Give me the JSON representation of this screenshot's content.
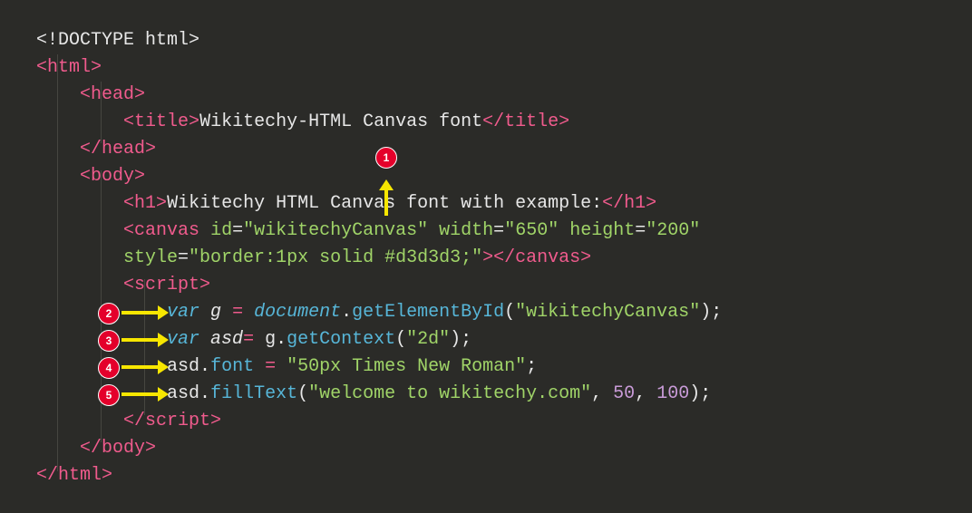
{
  "lines": {
    "l1": "<!DOCTYPE html>",
    "l2_open": "<",
    "l2_tag": "html",
    "l2_close": ">",
    "l3_open": "<",
    "l3_tag": "head",
    "l3_close": ">",
    "l4_open": "<",
    "l4_tag": "title",
    "l4_mid": ">",
    "l4_text": "Wikitechy-HTML Canvas font",
    "l4_copen": "</",
    "l4_cclose": ">",
    "l5_open": "</",
    "l5_tag": "head",
    "l5_close": ">",
    "l6_open": "<",
    "l6_tag": "body",
    "l6_close": ">",
    "l7_open": "<",
    "l7_tag": "h1",
    "l7_mid": ">",
    "l7_text": "Wikitechy HTML Canvas font with example:",
    "l7_copen": "</",
    "l7_cclose": ">",
    "l8_open": "<",
    "l8_tag": "canvas",
    "l8_sp": " ",
    "l8_a1": "id",
    "l8_eq": "=",
    "l8_v1": "\"wikitechyCanvas\"",
    "l8_a2": "width",
    "l8_v2": "\"650\"",
    "l8_a3": "height",
    "l8_v3": "\"200\"",
    "l9_a4": "style",
    "l9_v4": "\"border:1px solid #d3d3d3;\"",
    "l9_mid": ">",
    "l9_copen": "</",
    "l9_ctag": "canvas",
    "l9_cclose": ">",
    "l10_open": "<",
    "l10_tag": "script",
    "l10_close": ">",
    "l11_var": "var",
    "l11_g": " g ",
    "l11_eq": "= ",
    "l11_doc": "document",
    "l11_dot": ".",
    "l11_fn": "getElementById",
    "l11_p1": "(",
    "l11_str": "\"wikitechyCanvas\"",
    "l11_p2": ");",
    "l12_var": "var",
    "l12_asd": " asd",
    "l12_eq": "= ",
    "l12_g": "g",
    "l12_dot": ".",
    "l12_fn": "getContext",
    "l12_p1": "(",
    "l12_str": "\"2d\"",
    "l12_p2": ");",
    "l13_obj": "asd",
    "l13_dot": ".",
    "l13_prop": "font",
    "l13_sp": " ",
    "l13_eq": "= ",
    "l13_str": "\"50px Times New Roman\"",
    "l13_end": ";",
    "l14_obj": "asd",
    "l14_dot": ".",
    "l14_fn": "fillText",
    "l14_p1": "(",
    "l14_str": "\"welcome to wikitechy.com\"",
    "l14_c1": ", ",
    "l14_n1": "50",
    "l14_c2": ", ",
    "l14_n2": "100",
    "l14_p2": ");",
    "l15_open": "</",
    "l15_tag": "script",
    "l15_close": ">",
    "l16_open": "</",
    "l16_tag": "body",
    "l16_close": ">",
    "l17_open": "</",
    "l17_tag": "html",
    "l17_close": ">"
  },
  "badges": {
    "b1": "1",
    "b2": "2",
    "b3": "3",
    "b4": "4",
    "b5": "5"
  }
}
